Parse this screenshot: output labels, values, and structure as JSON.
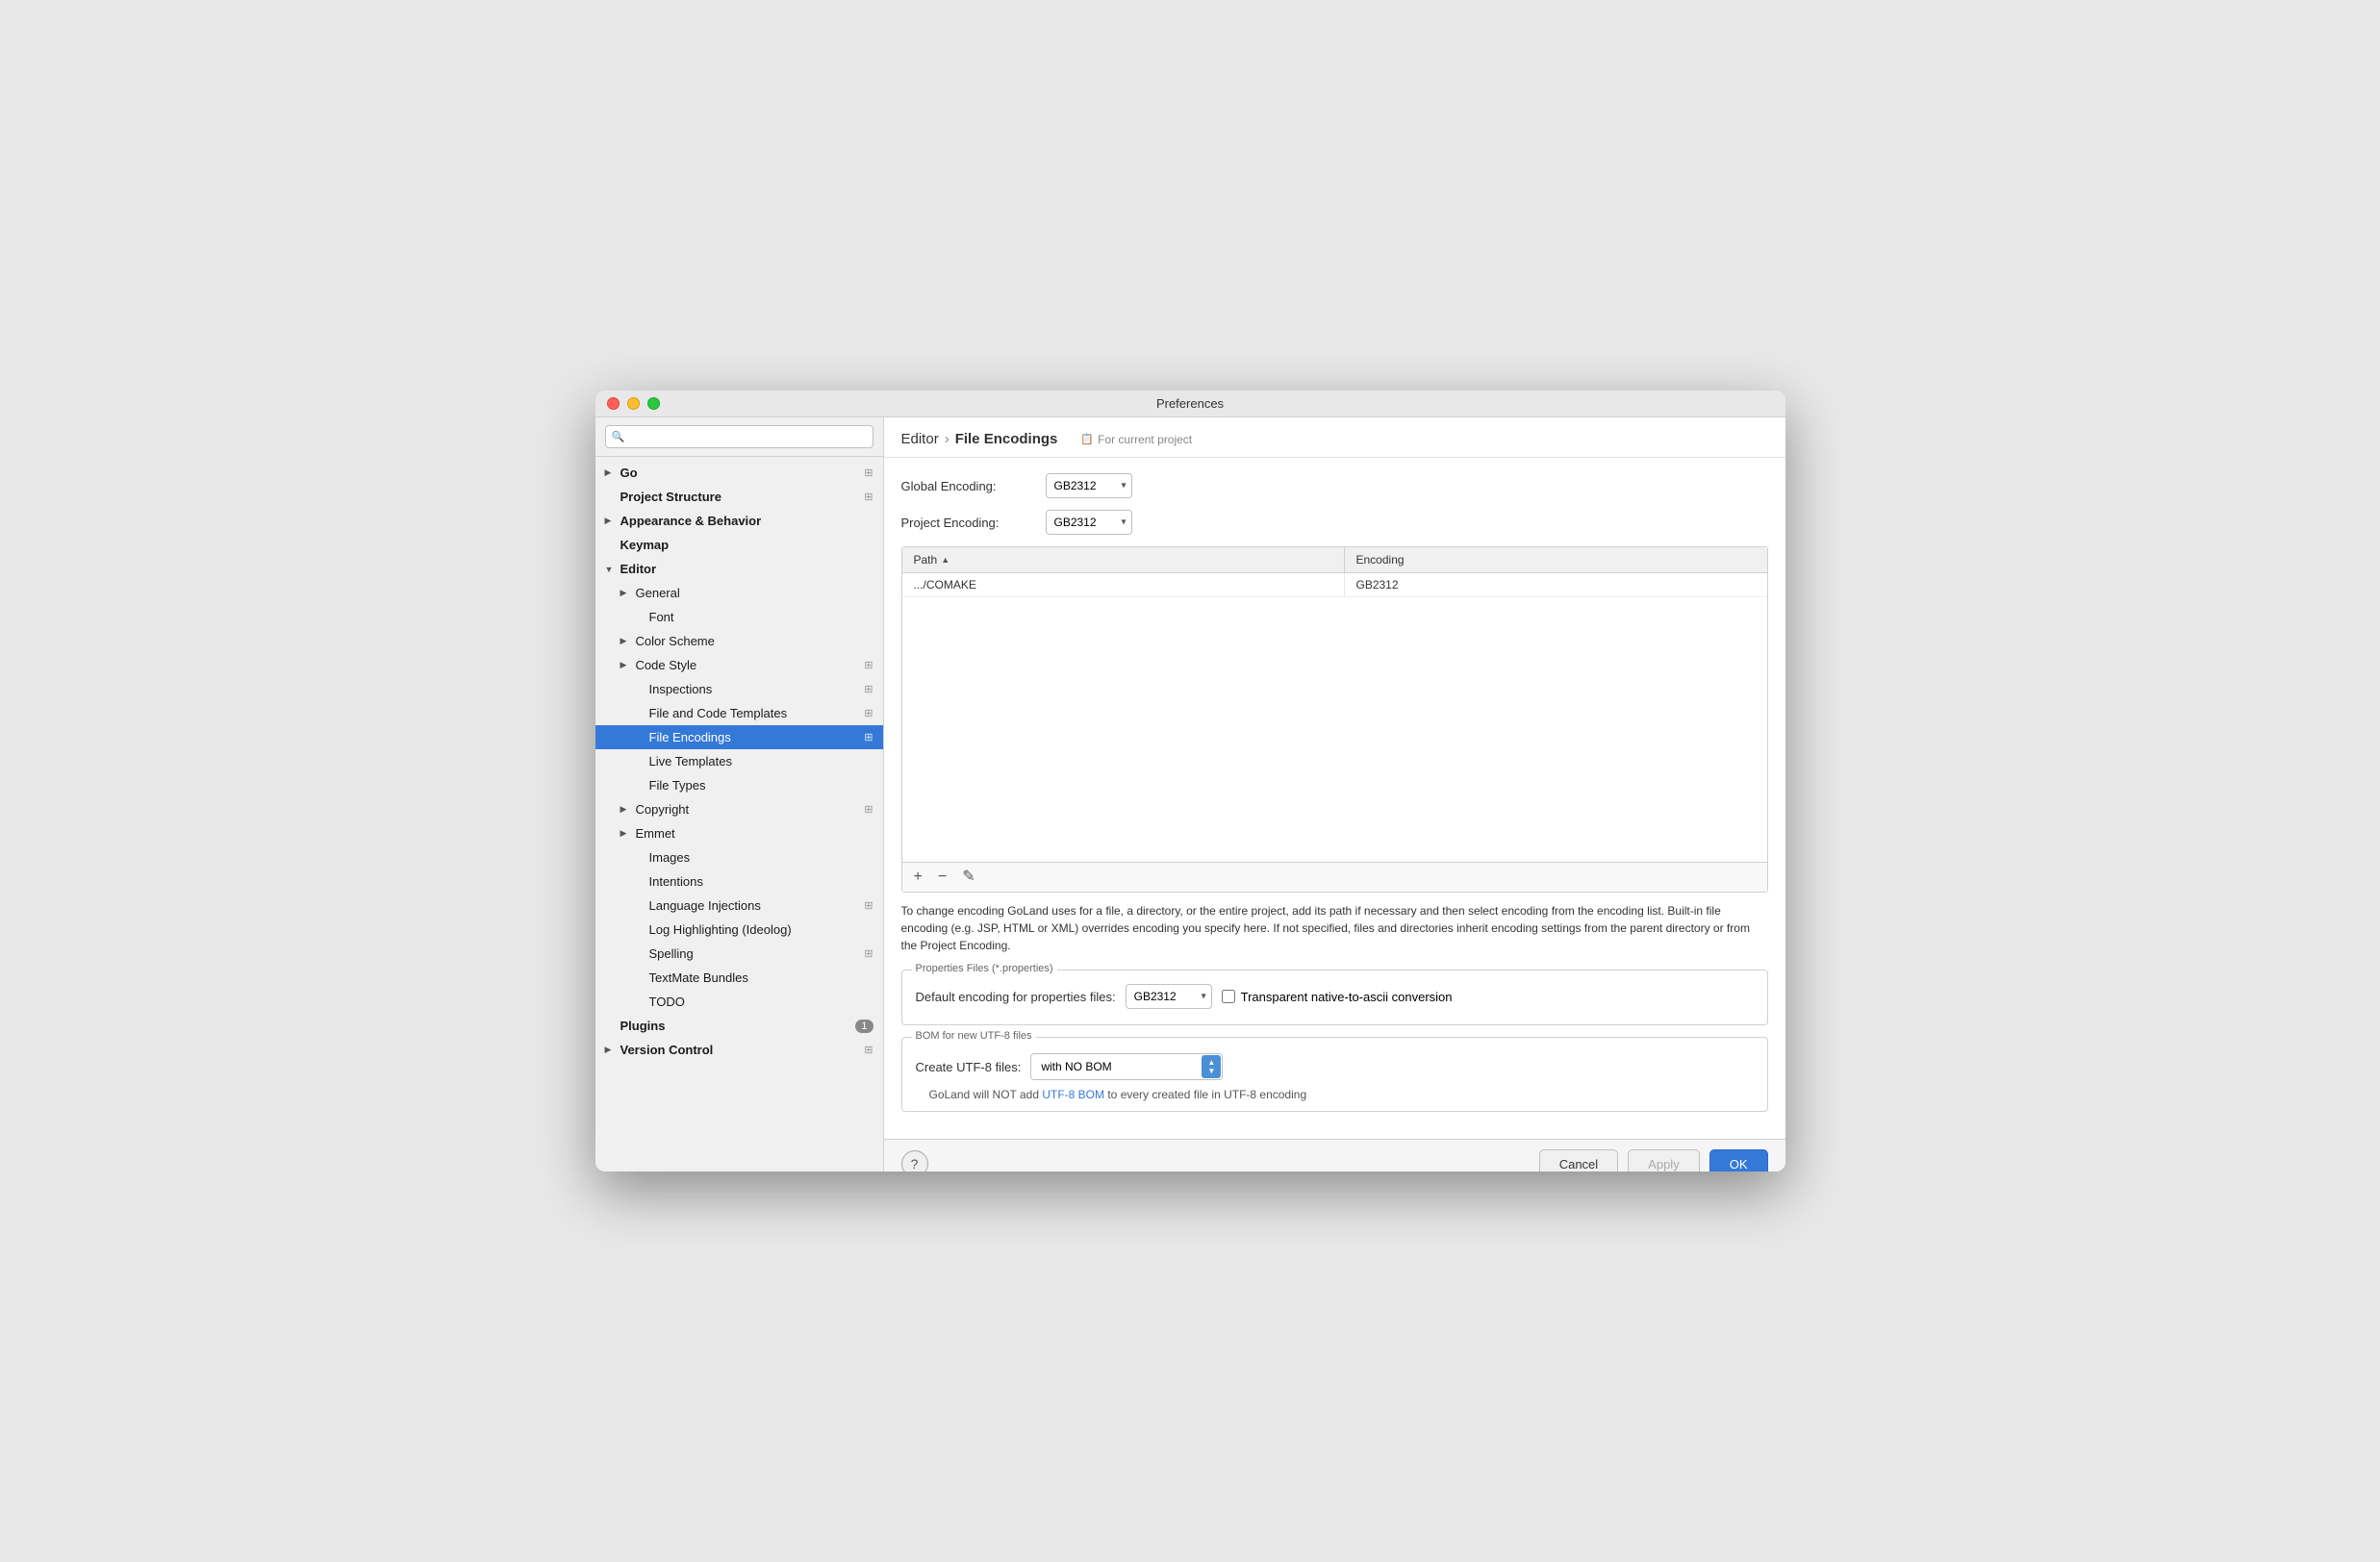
{
  "window": {
    "title": "Preferences"
  },
  "sidebar": {
    "search_placeholder": "🔍",
    "items": [
      {
        "id": "go",
        "label": "Go",
        "level": 0,
        "arrow": "▶",
        "has_icon": true,
        "copy": true
      },
      {
        "id": "project-structure",
        "label": "Project Structure",
        "level": 0,
        "arrow": "",
        "copy": true
      },
      {
        "id": "appearance-behavior",
        "label": "Appearance & Behavior",
        "level": 0,
        "arrow": "▶",
        "copy": false
      },
      {
        "id": "keymap",
        "label": "Keymap",
        "level": 0,
        "arrow": "",
        "copy": false
      },
      {
        "id": "editor",
        "label": "Editor",
        "level": 0,
        "arrow": "▼",
        "copy": false,
        "bold": true
      },
      {
        "id": "general",
        "label": "General",
        "level": 1,
        "arrow": "▶",
        "copy": false
      },
      {
        "id": "font",
        "label": "Font",
        "level": 2,
        "arrow": "",
        "copy": false
      },
      {
        "id": "color-scheme",
        "label": "Color Scheme",
        "level": 1,
        "arrow": "▶",
        "copy": false
      },
      {
        "id": "code-style",
        "label": "Code Style",
        "level": 1,
        "arrow": "▶",
        "copy": true
      },
      {
        "id": "inspections",
        "label": "Inspections",
        "level": 2,
        "arrow": "",
        "copy": true
      },
      {
        "id": "file-code-templates",
        "label": "File and Code Templates",
        "level": 2,
        "arrow": "",
        "copy": true
      },
      {
        "id": "file-encodings",
        "label": "File Encodings",
        "level": 2,
        "arrow": "",
        "copy": true,
        "active": true
      },
      {
        "id": "live-templates",
        "label": "Live Templates",
        "level": 2,
        "arrow": "",
        "copy": false
      },
      {
        "id": "file-types",
        "label": "File Types",
        "level": 2,
        "arrow": "",
        "copy": false
      },
      {
        "id": "copyright",
        "label": "Copyright",
        "level": 1,
        "arrow": "▶",
        "copy": true
      },
      {
        "id": "emmet",
        "label": "Emmet",
        "level": 1,
        "arrow": "▶",
        "copy": false
      },
      {
        "id": "images",
        "label": "Images",
        "level": 2,
        "arrow": "",
        "copy": false
      },
      {
        "id": "intentions",
        "label": "Intentions",
        "level": 2,
        "arrow": "",
        "copy": false
      },
      {
        "id": "language-injections",
        "label": "Language Injections",
        "level": 2,
        "arrow": "",
        "copy": true
      },
      {
        "id": "log-highlighting",
        "label": "Log Highlighting (Ideolog)",
        "level": 2,
        "arrow": "",
        "copy": false
      },
      {
        "id": "spelling",
        "label": "Spelling",
        "level": 2,
        "arrow": "",
        "copy": true
      },
      {
        "id": "textmate-bundles",
        "label": "TextMate Bundles",
        "level": 2,
        "arrow": "",
        "copy": false
      },
      {
        "id": "todo",
        "label": "TODO",
        "level": 2,
        "arrow": "",
        "copy": false
      },
      {
        "id": "plugins",
        "label": "Plugins",
        "level": 0,
        "arrow": "",
        "copy": false,
        "badge": "1"
      },
      {
        "id": "version-control",
        "label": "Version Control",
        "level": 0,
        "arrow": "▶",
        "copy": true
      }
    ]
  },
  "breadcrumb": {
    "parent": "Editor",
    "separator": "›",
    "current": "File Encodings"
  },
  "for_project_label": "For current project",
  "global_encoding": {
    "label": "Global Encoding:",
    "value": "GB2312"
  },
  "project_encoding": {
    "label": "Project Encoding:",
    "value": "GB2312"
  },
  "table": {
    "col_path": "Path",
    "col_encoding": "Encoding",
    "sort_indicator": "▲",
    "rows": [
      {
        "path": ".../COMAKE",
        "encoding": "GB2312"
      }
    ]
  },
  "toolbar": {
    "add_label": "+",
    "remove_label": "−",
    "edit_label": "✎"
  },
  "description": "To change encoding GoLand uses for a file, a directory, or the entire project, add its path if necessary and then select encoding from the encoding list. Built-in file encoding (e.g. JSP, HTML or XML) overrides encoding you specify here. If not specified, files and directories inherit encoding settings from the parent directory or from the Project Encoding.",
  "properties_section": {
    "title": "Properties Files (*.properties)",
    "default_encoding_label": "Default encoding for properties files:",
    "default_encoding_value": "GB2312",
    "transparent_label": "Transparent native-to-ascii conversion"
  },
  "bom_section": {
    "title": "BOM for new UTF-8 files",
    "create_label": "Create UTF-8 files:",
    "create_value": "with NO BOM",
    "note_text": "GoLand will NOT add ",
    "note_link": "UTF-8 BOM",
    "note_suffix": " to every created file in UTF-8 encoding"
  },
  "buttons": {
    "help": "?",
    "cancel": "Cancel",
    "apply": "Apply",
    "ok": "OK"
  }
}
